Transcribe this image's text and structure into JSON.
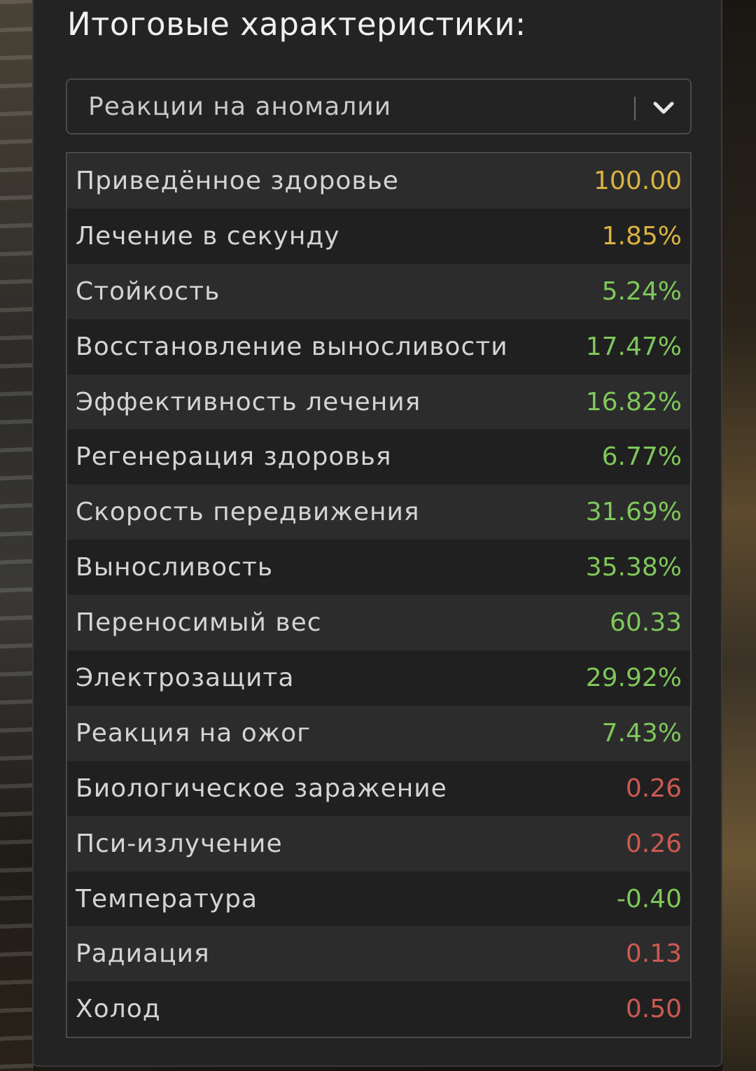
{
  "panel": {
    "title": "Итоговые характеристики:"
  },
  "dropdown": {
    "selected": "Реакции на аномалии",
    "icon": "chevron-down-icon"
  },
  "colors": {
    "yellow": "#d9b341",
    "green": "#7fc75a",
    "red": "#cc5a52"
  },
  "stats": [
    {
      "label": "Приведённое здоровье",
      "value": "100.00",
      "color": "#d9b341"
    },
    {
      "label": "Лечение в секунду",
      "value": "1.85%",
      "color": "#d9b341"
    },
    {
      "label": "Стойкость",
      "value": "5.24%",
      "color": "#7fc75a"
    },
    {
      "label": "Восстановление выносливости",
      "value": "17.47%",
      "color": "#7fc75a"
    },
    {
      "label": "Эффективность лечения",
      "value": "16.82%",
      "color": "#7fc75a"
    },
    {
      "label": "Регенерация здоровья",
      "value": "6.77%",
      "color": "#7fc75a"
    },
    {
      "label": "Скорость передвижения",
      "value": "31.69%",
      "color": "#7fc75a"
    },
    {
      "label": "Выносливость",
      "value": "35.38%",
      "color": "#7fc75a"
    },
    {
      "label": "Переносимый вес",
      "value": "60.33",
      "color": "#7fc75a"
    },
    {
      "label": "Электрозащита",
      "value": "29.92%",
      "color": "#7fc75a"
    },
    {
      "label": "Реакция на ожог",
      "value": "7.43%",
      "color": "#7fc75a"
    },
    {
      "label": "Биологическое заражение",
      "value": "0.26",
      "color": "#cc5a52"
    },
    {
      "label": "Пси-излучение",
      "value": "0.26",
      "color": "#cc5a52"
    },
    {
      "label": "Температура",
      "value": "-0.40",
      "color": "#7fc75a"
    },
    {
      "label": "Радиация",
      "value": "0.13",
      "color": "#cc5a52"
    },
    {
      "label": "Холод",
      "value": "0.50",
      "color": "#cc5a52"
    }
  ]
}
